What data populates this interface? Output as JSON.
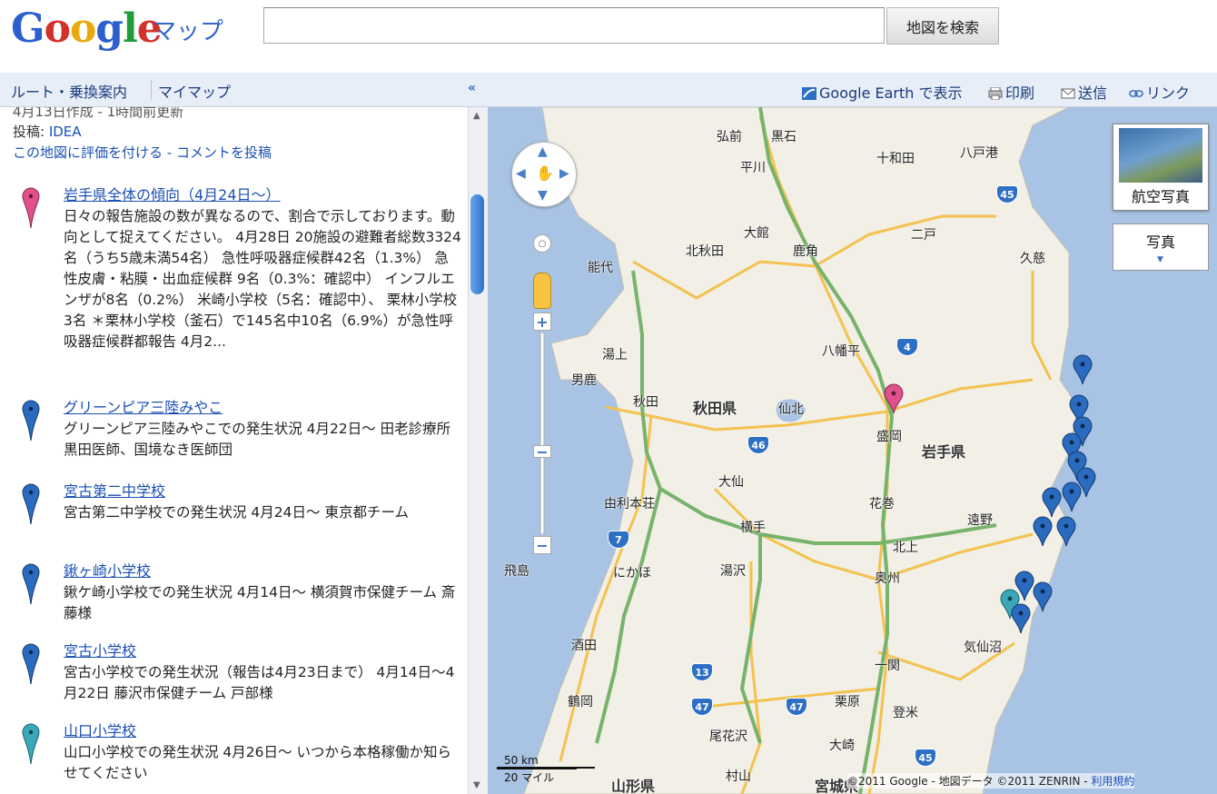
{
  "header": {
    "logo": "Google",
    "logo_sub": "マップ",
    "search_value": "",
    "search_button": "地図を検索"
  },
  "sidebar": {
    "tabs": [
      "ルート・乗換案内",
      "マイマップ"
    ],
    "collapse": "«",
    "meta_line": "4月13日作成 - 1時間前更新",
    "poster_label": "投稿: ",
    "poster_value": "IDEA",
    "rate_link": "この地図に評価を付ける - コメントを投稿",
    "entries": [
      {
        "title": "岩手県全体の傾向（4月24日～）",
        "pin_color": "#e0508a",
        "desc": "日々の報告施設の数が異なるので、割合で示しております。動向として捉えてください。 4月28日 20施設の避難者総数3324名（うち5歳未満54名） 急性呼吸器症候群42名（1.3%） 急性皮膚・粘膜・出血症候群 9名（0.3%：確認中） インフルエンザが8名（0.2%） 米崎小学校（5名：確認中）、 栗林小学校3名 ＊栗林小学校（釜石）で145名中10名（6.9%）が急性呼吸器症候群都報告 4月2..."
      },
      {
        "title": "グリーンピア三陸みやこ",
        "pin_color": "#2a6bbf",
        "desc": "グリーンピア三陸みやこでの発生状況 4月22日～ 田老診療所 黒田医師、国境なき医師団"
      },
      {
        "title": "宮古第二中学校",
        "pin_color": "#2a6bbf",
        "desc": "宮古第二中学校での発生状況 4月24日～ 東京都チーム"
      },
      {
        "title": "鍬ヶ崎小学校",
        "pin_color": "#2a6bbf",
        "desc": "鍬ケ崎小学校での発生状況 4月14日～ 横須賀市保健チーム 斎藤様"
      },
      {
        "title": "宮古小学校",
        "pin_color": "#2a6bbf",
        "desc": "宮古小学校での発生状況（報告は4月23日まで） 4月14日～4月22日 藤沢市保健チーム 戸部様"
      },
      {
        "title": "山口小学校",
        "pin_color": "#3aa8b8",
        "desc": "山口小学校での発生状況 4月26日～ いつから本格稼働か知らせてください"
      }
    ]
  },
  "map_toolbar": {
    "earth": "Google Earth で表示",
    "print": "印刷",
    "send": "送信",
    "link": "リンク"
  },
  "map": {
    "aerial_label": "航空写真",
    "photo_label": "写真",
    "scale_km": "50 km",
    "scale_mi": "20 マイル",
    "copyright": "©2011 Google - 地図データ ©2011 ZENRIN - ",
    "terms": "利用規約",
    "prefectures": [
      "秋田県",
      "岩手県",
      "山形県",
      "宮城県"
    ],
    "cities": [
      "弘前",
      "黒石",
      "十和田",
      "八戸港",
      "平川",
      "大館",
      "北秋田",
      "鹿角",
      "二戸",
      "久慈",
      "能代",
      "八幡平",
      "湯上",
      "男鹿",
      "秋田",
      "仙北",
      "盛岡",
      "大仙",
      "花巻",
      "遠野",
      "由利本荘",
      "横手",
      "北上",
      "飛島",
      "にかほ",
      "湯沢",
      "奥州",
      "酒田",
      "一関",
      "気仙沼",
      "鶴岡",
      "栗原",
      "登米",
      "尾花沢",
      "大崎",
      "村山"
    ],
    "routes": [
      "45",
      "4",
      "46",
      "7",
      "13",
      "47",
      "47",
      "45"
    ],
    "colors": {
      "sea": "#a8c3e3",
      "land": "#f2efe6",
      "highway": "#76b36b",
      "road": "#f3c24f"
    }
  }
}
